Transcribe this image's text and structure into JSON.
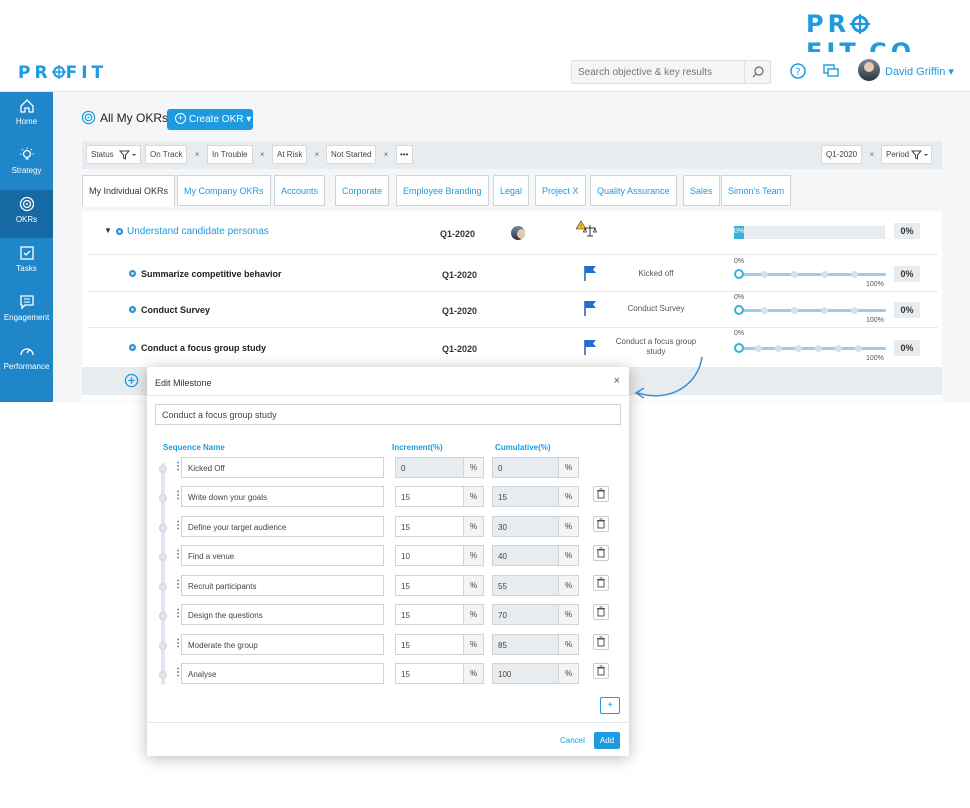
{
  "brand_top": "PR",
  "brand_top_parts": [
    "PR",
    "F",
    "IT.CO"
  ],
  "app": {
    "logo_parts": [
      "PR",
      "F",
      "IT"
    ],
    "search_placeholder": "Search objective & key results",
    "user_name": "David Griffin",
    "sidebar": [
      {
        "label": "Home",
        "icon": "home-icon"
      },
      {
        "label": "Strategy",
        "icon": "bulb-icon"
      },
      {
        "label": "OKRs",
        "icon": "target-icon",
        "active": true
      },
      {
        "label": "Tasks",
        "icon": "tasks-icon"
      },
      {
        "label": "Engagement",
        "icon": "chat-icon"
      },
      {
        "label": "Performance",
        "icon": "gauge-icon"
      }
    ],
    "page_title": "All My OKRs",
    "create_btn": "Create OKR",
    "filters": {
      "status": "Status",
      "chips": [
        "On Track",
        "In Trouble",
        "At Risk",
        "Not Started"
      ],
      "more": "•••",
      "period_value": "Q1-2020",
      "period_label": "Period"
    },
    "tabs": [
      "My Individual OKRs",
      "My Company OKRs",
      "Accounts",
      "Corporate",
      "Employee Branding",
      "Legal",
      "Project X",
      "Quality Assurance",
      "Sales",
      "Simon's Team"
    ],
    "objective": {
      "title": "Understand candidate personas",
      "period": "Q1-2020",
      "progress_label": "0%",
      "pct": "0%"
    },
    "key_results": [
      {
        "title": "Summarize competitive behavior",
        "period": "Q1-2020",
        "status": "Kicked off",
        "start": "0%",
        "end": "100%",
        "pct": "0%"
      },
      {
        "title": "Conduct Survey",
        "period": "Q1-2020",
        "status": "Conduct Survey",
        "start": "0%",
        "end": "100%",
        "pct": "0%"
      },
      {
        "title": "Conduct a focus group study",
        "period": "Q1-2020",
        "status": "Conduct a focus group study",
        "start": "0%",
        "end": "100%",
        "pct": "0%"
      }
    ]
  },
  "modal": {
    "title": "Edit Milestone",
    "objective": "Conduct a focus group study",
    "col_name": "Sequence Name",
    "col_inc": "Increment(%)",
    "col_cum": "Cumulative(%)",
    "unit": "%",
    "rows": [
      {
        "name": "Kicked Off",
        "inc": "0",
        "cum": "0"
      },
      {
        "name": "Write down your goals",
        "inc": "15",
        "cum": "15"
      },
      {
        "name": " Define your target audience",
        "inc": "15",
        "cum": "30"
      },
      {
        "name": "Find a venue",
        "inc": "10",
        "cum": "40"
      },
      {
        "name": " Recruit participants",
        "inc": "15",
        "cum": "55"
      },
      {
        "name": "Design the questions",
        "inc": "15",
        "cum": "70"
      },
      {
        "name": "Moderate the group",
        "inc": "15",
        "cum": "85"
      },
      {
        "name": "Analyse",
        "inc": "15",
        "cum": "100"
      }
    ],
    "plus": "+",
    "cancel": "Cancel",
    "add": "Add"
  }
}
